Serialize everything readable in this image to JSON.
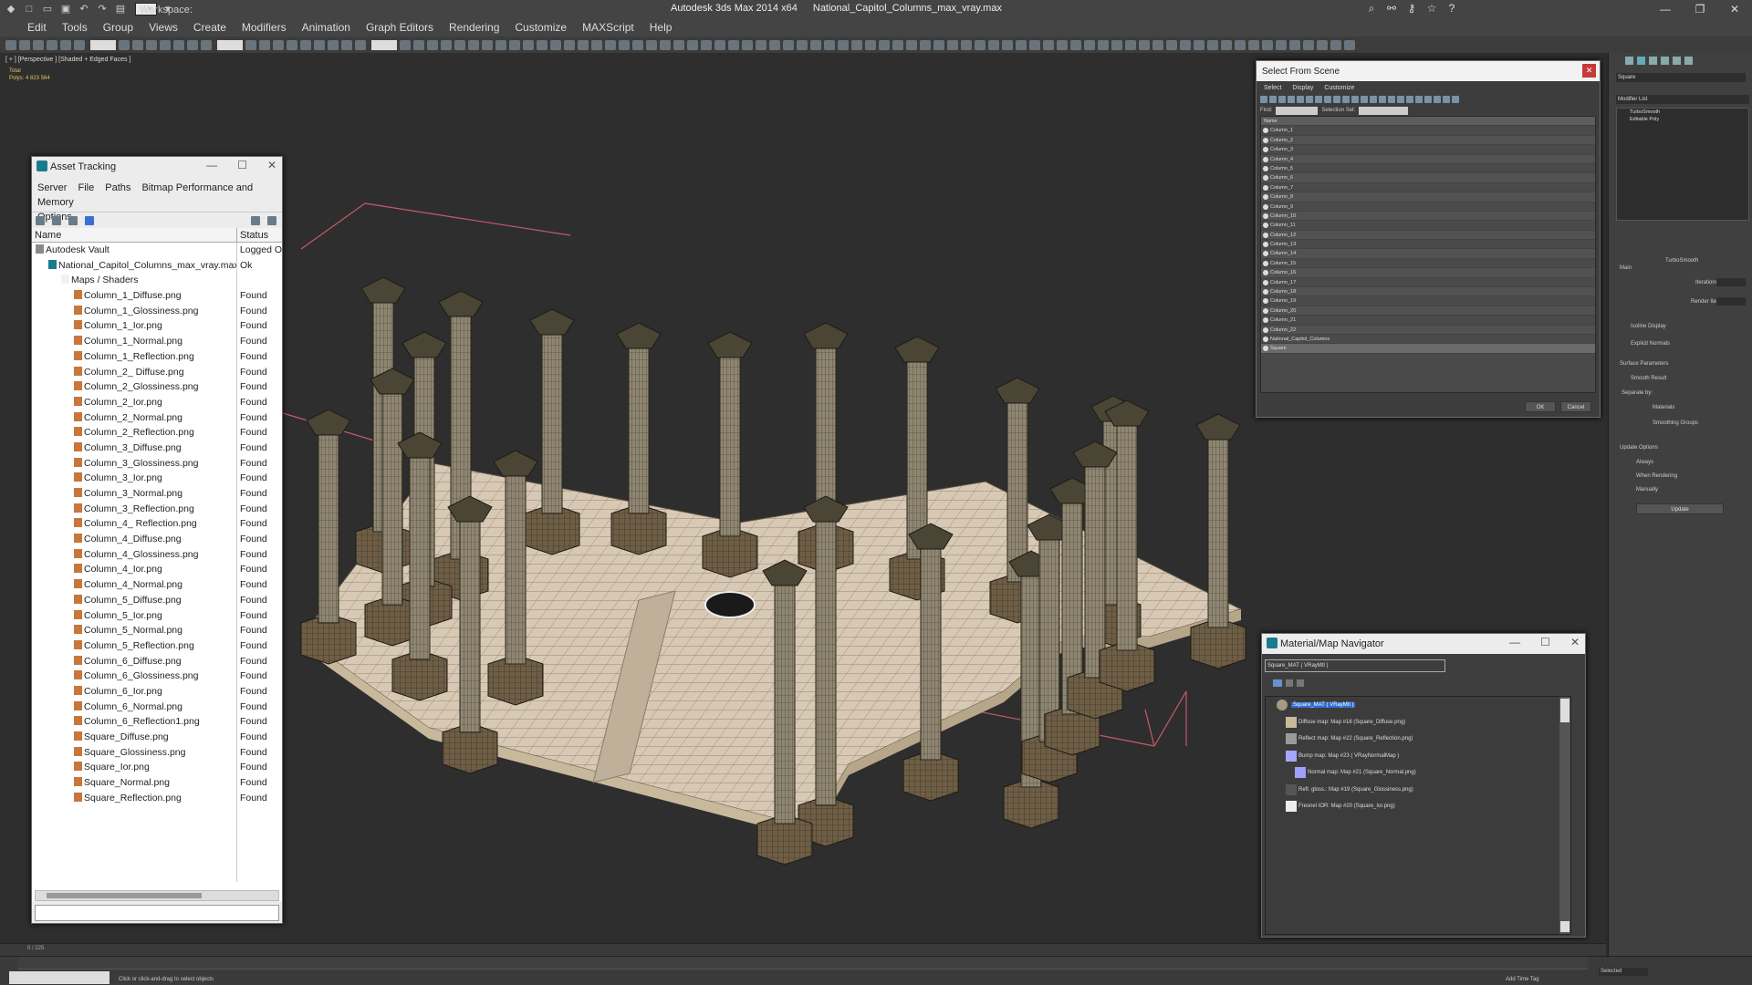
{
  "window": {
    "workspace": "Workspace: Default",
    "app": "Autodesk 3ds Max  2014 x64",
    "file": "National_Capitol_Columns_max_vray.max"
  },
  "menu": [
    "Edit",
    "Tools",
    "Group",
    "Views",
    "Create",
    "Modifiers",
    "Animation",
    "Graph Editors",
    "Rendering",
    "Customize",
    "MAXScript",
    "Help"
  ],
  "viewport": {
    "label": "[ + ] [Perspective ] [Shaded + Edged Faces ]",
    "stats_total": "Total",
    "stats_polys": "Polys:  4 823 564"
  },
  "asset_tracking": {
    "title": "Asset Tracking",
    "menu": [
      "Server",
      "File",
      "Paths",
      "Bitmap Performance and Memory",
      "Options"
    ],
    "col_name": "Name",
    "col_status": "Status",
    "rows": [
      {
        "name": "Autodesk Vault",
        "status": "Logged O",
        "indent": 0,
        "type": "vault"
      },
      {
        "name": "National_Capitol_Columns_max_vray.max",
        "status": "Ok",
        "indent": 1,
        "type": "max"
      },
      {
        "name": "Maps / Shaders",
        "status": "",
        "indent": 2,
        "type": "folder"
      },
      {
        "name": "Column_1_Diffuse.png",
        "status": "Found",
        "indent": 3,
        "type": "file"
      },
      {
        "name": "Column_1_Glossiness.png",
        "status": "Found",
        "indent": 3,
        "type": "file"
      },
      {
        "name": "Column_1_Ior.png",
        "status": "Found",
        "indent": 3,
        "type": "file"
      },
      {
        "name": "Column_1_Normal.png",
        "status": "Found",
        "indent": 3,
        "type": "file"
      },
      {
        "name": "Column_1_Reflection.png",
        "status": "Found",
        "indent": 3,
        "type": "file"
      },
      {
        "name": "Column_2_ Diffuse.png",
        "status": "Found",
        "indent": 3,
        "type": "file"
      },
      {
        "name": "Column_2_Glossiness.png",
        "status": "Found",
        "indent": 3,
        "type": "file"
      },
      {
        "name": "Column_2_Ior.png",
        "status": "Found",
        "indent": 3,
        "type": "file"
      },
      {
        "name": "Column_2_Normal.png",
        "status": "Found",
        "indent": 3,
        "type": "file"
      },
      {
        "name": "Column_2_Reflection.png",
        "status": "Found",
        "indent": 3,
        "type": "file"
      },
      {
        "name": "Column_3_Diffuse.png",
        "status": "Found",
        "indent": 3,
        "type": "file"
      },
      {
        "name": "Column_3_Glossiness.png",
        "status": "Found",
        "indent": 3,
        "type": "file"
      },
      {
        "name": "Column_3_Ior.png",
        "status": "Found",
        "indent": 3,
        "type": "file"
      },
      {
        "name": "Column_3_Normal.png",
        "status": "Found",
        "indent": 3,
        "type": "file"
      },
      {
        "name": "Column_3_Reflection.png",
        "status": "Found",
        "indent": 3,
        "type": "file"
      },
      {
        "name": "Column_4_ Reflection.png",
        "status": "Found",
        "indent": 3,
        "type": "file"
      },
      {
        "name": "Column_4_Diffuse.png",
        "status": "Found",
        "indent": 3,
        "type": "file"
      },
      {
        "name": "Column_4_Glossiness.png",
        "status": "Found",
        "indent": 3,
        "type": "file"
      },
      {
        "name": "Column_4_Ior.png",
        "status": "Found",
        "indent": 3,
        "type": "file"
      },
      {
        "name": "Column_4_Normal.png",
        "status": "Found",
        "indent": 3,
        "type": "file"
      },
      {
        "name": "Column_5_Diffuse.png",
        "status": "Found",
        "indent": 3,
        "type": "file"
      },
      {
        "name": "Column_5_Ior.png",
        "status": "Found",
        "indent": 3,
        "type": "file"
      },
      {
        "name": "Column_5_Normal.png",
        "status": "Found",
        "indent": 3,
        "type": "file"
      },
      {
        "name": "Column_5_Reflection.png",
        "status": "Found",
        "indent": 3,
        "type": "file"
      },
      {
        "name": "Column_6_Diffuse.png",
        "status": "Found",
        "indent": 3,
        "type": "file"
      },
      {
        "name": "Column_6_Glossiness.png",
        "status": "Found",
        "indent": 3,
        "type": "file"
      },
      {
        "name": "Column_6_Ior.png",
        "status": "Found",
        "indent": 3,
        "type": "file"
      },
      {
        "name": "Column_6_Normal.png",
        "status": "Found",
        "indent": 3,
        "type": "file"
      },
      {
        "name": "Column_6_Reflection1.png",
        "status": "Found",
        "indent": 3,
        "type": "file"
      },
      {
        "name": "Square_Diffuse.png",
        "status": "Found",
        "indent": 3,
        "type": "file"
      },
      {
        "name": "Square_Glossiness.png",
        "status": "Found",
        "indent": 3,
        "type": "file"
      },
      {
        "name": "Square_Ior.png",
        "status": "Found",
        "indent": 3,
        "type": "file"
      },
      {
        "name": "Square_Normal.png",
        "status": "Found",
        "indent": 3,
        "type": "file"
      },
      {
        "name": "Square_Reflection.png",
        "status": "Found",
        "indent": 3,
        "type": "file"
      }
    ]
  },
  "select_from_scene": {
    "title": "Select From Scene",
    "menu": [
      "Select",
      "Display",
      "Customize"
    ],
    "find_label": "Find:",
    "selection_set_label": "Selection Set:",
    "col_name": "Name",
    "items": [
      "Column_1",
      "Column_2",
      "Column_3",
      "Column_4",
      "Column_5",
      "Column_6",
      "Column_7",
      "Column_8",
      "Column_9",
      "Column_10",
      "Column_11",
      "Column_12",
      "Column_13",
      "Column_14",
      "Column_15",
      "Column_16",
      "Column_17",
      "Column_18",
      "Column_19",
      "Column_20",
      "Column_21",
      "Column_22",
      "National_Capitol_Columns",
      "Square"
    ],
    "ok": "OK",
    "cancel": "Cancel"
  },
  "material_navigator": {
    "title": "Material/Map Navigator",
    "material_name": "Square_MAT  ( VRayMtl )",
    "root": "Square_MAT  ( VRayMtl )",
    "maps": [
      "Diffuse map: Map #18 (Square_Diffuse.png)",
      "Reflect map: Map #22 (Square_Reflection.png)",
      "Bump map: Map #23  ( VRayNormalMap )",
      "Normal map: Map #21 (Square_Normal.png)",
      "Refl. gloss.: Map #19 (Square_Glossiness.png)",
      "Fresnel IOR: Map #20 (Square_Ior.png)"
    ]
  },
  "command_panel": {
    "object_name": "Square",
    "modifier_list": "Modifier List",
    "stack": [
      "TurboSmooth",
      "Editable Poly"
    ],
    "rollout_title": "TurboSmooth",
    "main": "Main",
    "iterations": "Iterations:",
    "render_iters": "Render Iters:",
    "isoline": "Isoline Display",
    "explicit_normals": "Explicit Normals",
    "surface_params": "Surface Parameters",
    "smooth_result": "Smooth Result",
    "separate_by": "Separate by:",
    "materials": "Materials",
    "smoothing_groups": "Smoothing Groups",
    "update_options": "Update Options",
    "always": "Always",
    "when_rendering": "When Rendering",
    "manually": "Manually",
    "update": "Update"
  },
  "timeline": {
    "frame": "0 / 225"
  },
  "status": {
    "prompt": "Click or click-and-drag to select objects",
    "selected": "Selected",
    "add_time_tag": "Add Time Tag"
  }
}
